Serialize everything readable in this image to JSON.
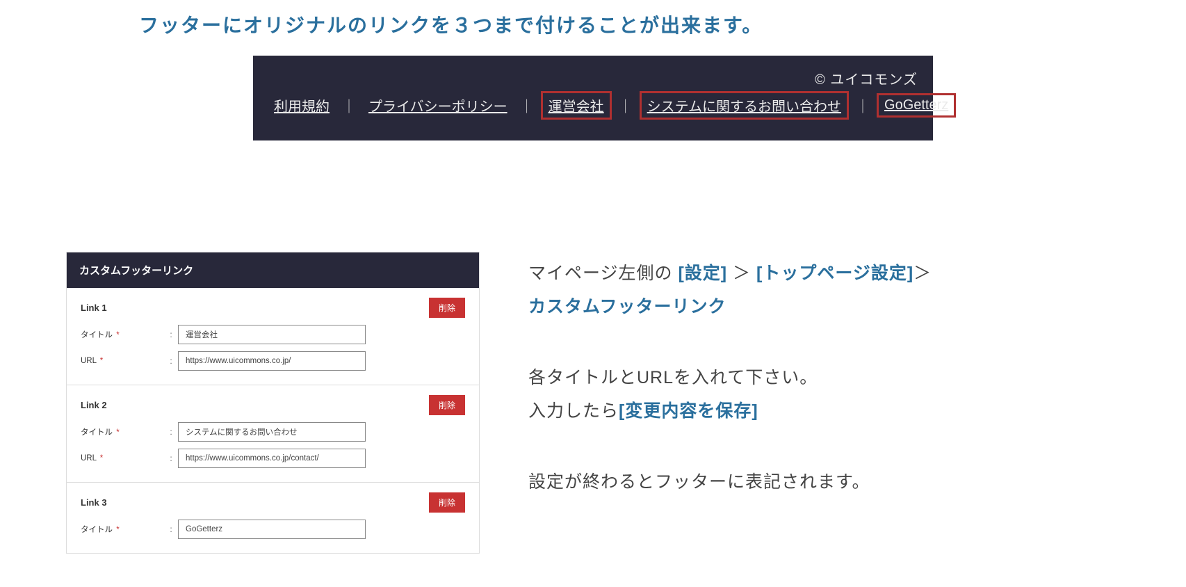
{
  "heading": "フッターにオリジナルのリンクを３つまで付けることが出来ます。",
  "footer_preview": {
    "copyright": "© ユイコモンズ",
    "links": [
      {
        "label": "利用規約",
        "boxed": false
      },
      {
        "label": "プライバシーポリシー",
        "boxed": false
      },
      {
        "label": "運営会社",
        "boxed": true
      },
      {
        "label": "システムに関するお問い合わせ",
        "boxed": true
      },
      {
        "label": "GoGetterz",
        "boxed": true
      }
    ],
    "separator": "｜"
  },
  "admin_panel": {
    "header": "カスタムフッターリンク",
    "field_labels": {
      "title": "タイトル",
      "url": "URL"
    },
    "required_mark": "*",
    "colon": ":",
    "delete_label": "削除",
    "links": [
      {
        "name": "Link 1",
        "title": "運営会社",
        "url": "https://www.uicommons.co.jp/"
      },
      {
        "name": "Link 2",
        "title": "システムに関するお問い合わせ",
        "url": "https://www.uicommons.co.jp/contact/"
      },
      {
        "name": "Link 3",
        "title": "GoGetterz",
        "url": ""
      }
    ]
  },
  "instructions": {
    "p1_pre": "マイページ左側の ",
    "p1_hl1": "[設定]",
    "p1_mid1": " ＞ ",
    "p1_hl2": "[トップページ設定]",
    "p1_mid2": "＞ ",
    "p1_hl3": "カスタムフッターリンク",
    "p2_l1": "各タイトルとURLを入れて下さい。",
    "p2_l2_pre": "入力したら",
    "p2_l2_hl": "[変更内容を保存]",
    "p3": "設定が終わるとフッターに表記されます。"
  }
}
